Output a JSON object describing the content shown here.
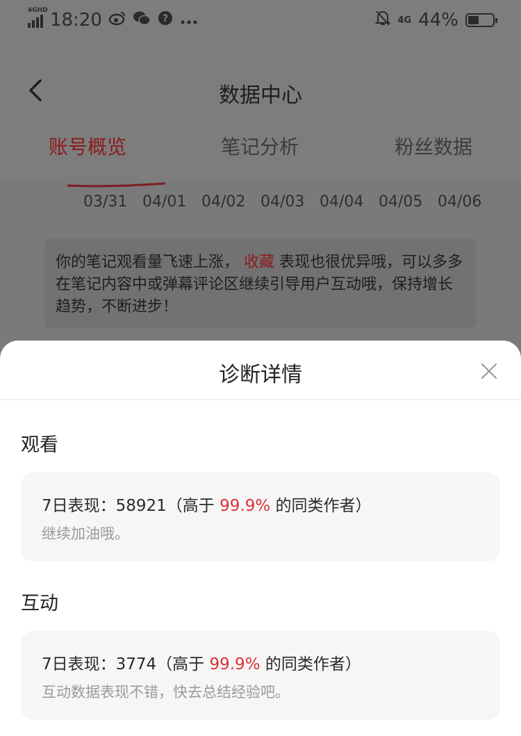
{
  "status_bar": {
    "network_tag": "4GHD",
    "time": "18:20",
    "right_network": "4G",
    "battery": "44%",
    "battery_level": 0.44,
    "icons": [
      "weibo-icon",
      "wechat-icon",
      "question-icon",
      "more-dots-icon",
      "bell-muted-icon",
      "signal-icon",
      "battery-icon"
    ]
  },
  "header": {
    "title": "数据中心"
  },
  "tabs": [
    {
      "label": "账号概览",
      "active": true
    },
    {
      "label": "笔记分析",
      "active": false
    },
    {
      "label": "粉丝数据",
      "active": false
    }
  ],
  "chart_dates": [
    "03/31",
    "04/01",
    "04/02",
    "04/03",
    "04/04",
    "04/05",
    "04/06"
  ],
  "summary": {
    "part1": "你的笔记观看量飞速上涨，",
    "highlight": "收藏",
    "part2": "表现也很优异哦，可以多多在笔记内容中或弹幕评论区继续引导用户互动哦，保持增长趋势，不断进步！"
  },
  "sheet": {
    "title": "诊断详情",
    "sections": [
      {
        "label": "观看",
        "prefix": "7日表现：58921（高于",
        "percent": "99.9%",
        "suffix": "的同类作者）",
        "note": "继续加油哦。"
      },
      {
        "label": "互动",
        "prefix": "7日表现：3774（高于",
        "percent": "99.9%",
        "suffix": "的同类作者）",
        "note": "互动数据表现不错，快去总结经验吧。"
      }
    ]
  },
  "colors": {
    "accent": "#d8323a",
    "tab_active_dim": "#8b1a1e"
  }
}
